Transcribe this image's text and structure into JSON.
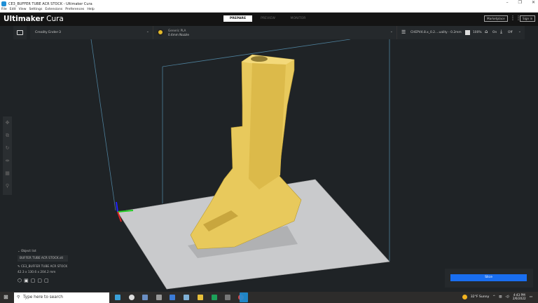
{
  "window": {
    "title": "CE3_BUFFER TUBE ACR STOCK - Ultimaker Cura",
    "controls": [
      "–",
      "❐",
      "✕"
    ]
  },
  "menu": [
    "File",
    "Edit",
    "View",
    "Settings",
    "Extensions",
    "Preferences",
    "Help"
  ],
  "header": {
    "logo_bold": "Ultimaker",
    "logo_light": " Cura",
    "stages": [
      "PREPARE",
      "PREVIEW",
      "MONITOR"
    ],
    "marketplace": "Marketplace",
    "signin": "Sign in"
  },
  "stagebar": {
    "printer": "Creality Ender-3",
    "material": "Generic PLA",
    "nozzle": "0.4mm Nozzle",
    "profile": "CHEPV4.8.x_0.2....uality - 0.2mm",
    "infill": "100%",
    "support": "On",
    "adhesion": "Off"
  },
  "objects": {
    "header": "Object list",
    "file": "BUFFER TUBE ACR STOCK.stl",
    "name": "CE3_BUFFER TUBE ACR STOCK",
    "dims": "42.3 x 130.6 x 204.2 mm"
  },
  "slice": {
    "label": "Slice"
  },
  "taskbar": {
    "search": "Type here to search",
    "weather": "32°F  Sunny",
    "time": "4:43 PM",
    "date": "2/6/2022"
  },
  "colors": {
    "accent": "#196ef0",
    "model": "#e8c95c"
  }
}
